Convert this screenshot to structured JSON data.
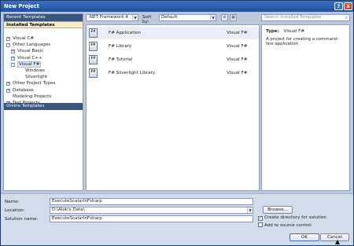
{
  "window": {
    "title": "New Project",
    "help_glyph": "?",
    "close_glyph": "X"
  },
  "left": {
    "recent_templates": "Recent Templates",
    "installed_templates": "Installed Templates",
    "online_templates": "Online Templates",
    "tree": [
      {
        "label": "Visual C#",
        "depth": 0,
        "expander": "+"
      },
      {
        "label": "Other Languages",
        "depth": 0,
        "expander": "-"
      },
      {
        "label": "Visual Basic",
        "depth": 1,
        "expander": "+"
      },
      {
        "label": "Visual C++",
        "depth": 1,
        "expander": "+"
      },
      {
        "label": "Visual F#",
        "depth": 1,
        "expander": "-",
        "selected": true
      },
      {
        "label": "Windows",
        "depth": 2,
        "expander": ""
      },
      {
        "label": "Silverlight",
        "depth": 2,
        "expander": ""
      },
      {
        "label": "Other Project Types",
        "depth": 0,
        "expander": "+"
      },
      {
        "label": "Database",
        "depth": 0,
        "expander": "+"
      },
      {
        "label": "Modeling Projects",
        "depth": 0,
        "expander": ""
      },
      {
        "label": "Test Projects",
        "depth": 0,
        "expander": "+"
      }
    ]
  },
  "toolbar": {
    "framework": ".NET Framework 4",
    "sort_by_label": "Sort by:",
    "sort_value": "Default",
    "search_placeholder": "Search Installed Templates"
  },
  "templates": [
    {
      "name": "F# Application",
      "lang": "Visual F#",
      "selected": true,
      "icon": "fsharp-application-icon"
    },
    {
      "name": "F# Library",
      "lang": "Visual F#",
      "icon": "fsharp-library-icon"
    },
    {
      "name": "F# Tutorial",
      "lang": "Visual F#",
      "icon": "fsharp-tutorial-icon"
    },
    {
      "name": "F# Silverlight Library",
      "lang": "Visual F#",
      "icon": "fsharp-silverlight-library-icon"
    }
  ],
  "details": {
    "type_label": "Type:",
    "type_value": "Visual F#",
    "description": "A project for creating a command-line application"
  },
  "form": {
    "name_label": "Name:",
    "name_value": "ExecuteScalarInFsharp",
    "location_label": "Location:",
    "location_value": "D:\\Alok's Data\\",
    "solution_label": "Solution name:",
    "solution_value": "ExecuteScalarInFsharp",
    "browse": "Browse...",
    "create_dir": "Create directory for solution",
    "create_dir_checked": true,
    "add_source": "Add to source control",
    "add_source_checked": false,
    "ok": "OK",
    "cancel": "Cancel"
  }
}
